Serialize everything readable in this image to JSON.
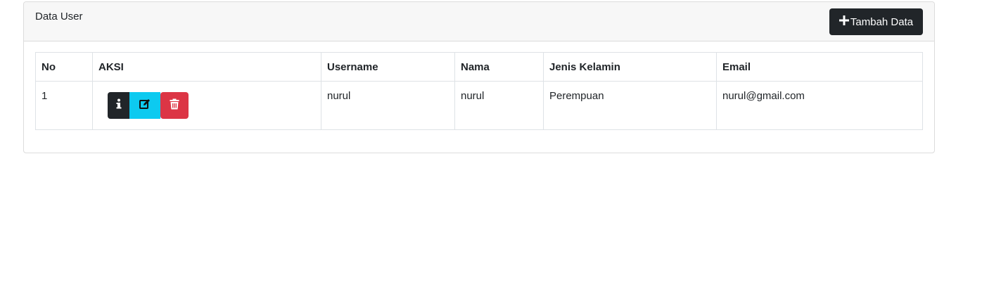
{
  "card": {
    "title": "Data User",
    "add_button_label": "Tambah Data"
  },
  "table": {
    "headers": [
      "No",
      "AKSI",
      "Username",
      "Nama",
      "Jenis Kelamin",
      "Email"
    ],
    "rows": [
      {
        "no": "1",
        "username": "nurul",
        "nama": "nurul",
        "jenis_kelamin": "Perempuan",
        "email": "nurul@gmail.com"
      }
    ]
  },
  "actions": {
    "icons": [
      "info-icon",
      "edit-icon",
      "trash-icon"
    ]
  },
  "colors": {
    "dark": "#212529",
    "info": "#0dcaf0",
    "danger": "#dc3545"
  }
}
